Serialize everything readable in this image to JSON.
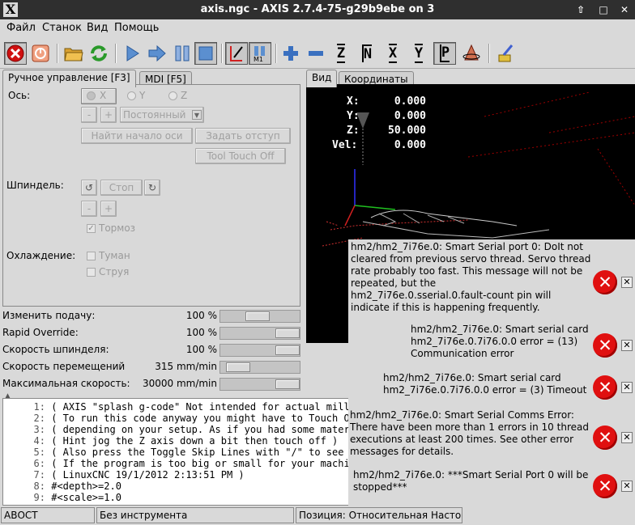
{
  "window": {
    "title": "axis.ngc - AXIS 2.7.4-75-g29b9ebe on 3",
    "logo": "X"
  },
  "menu": [
    "Файл",
    "Станок",
    "Вид",
    "Помощь"
  ],
  "toolbar": {
    "axis_buttons": [
      "Z",
      "N",
      "X",
      "Y",
      "P"
    ],
    "icons": [
      "estop-icon",
      "power-icon",
      "open-file-icon",
      "reload-icon",
      "run-icon",
      "step-icon",
      "pause-icon",
      "stop-icon",
      "skip-lines-icon",
      "optional-stop-icon",
      "zoom-in-icon",
      "zoom-out-icon",
      "view-z-icon",
      "view-z2-icon",
      "view-x-icon",
      "view-y-icon",
      "view-p-icon",
      "rotate-icon",
      "clear-plot-icon"
    ]
  },
  "left_tabs": [
    "Ручное управление [F3]",
    "MDI [F5]"
  ],
  "manual": {
    "axis_label": "Ось:",
    "axes": [
      "X",
      "Y",
      "Z"
    ],
    "minus": "-",
    "plus": "+",
    "jog_mode": "Постоянный",
    "home_button": "Найти начало оси",
    "offset_button": "Задать отступ",
    "touch_off_button": "Tool Touch Off",
    "spindle_label": "Шпиндель:",
    "spindle_stop": "Стоп",
    "brake_label": "Тормоз",
    "coolant_label": "Охлаждение:",
    "mist_label": "Туман",
    "flood_label": "Струя"
  },
  "sliders": [
    {
      "label": "Изменить подачу:",
      "value": "100 %",
      "level": 0.45
    },
    {
      "label": "Rapid Override:",
      "value": "100 %",
      "level": 1.0
    },
    {
      "label": "Скорость шпинделя:",
      "value": "100 %",
      "level": 1.0
    },
    {
      "label": "Скорость перемещений",
      "value": "315 mm/min",
      "level": 0.1
    },
    {
      "label": "Максимальная скорость:",
      "value": "30000 mm/min",
      "level": 1.0
    }
  ],
  "right_tabs": [
    "Вид",
    "Координаты"
  ],
  "dro": {
    "x_label": "X:",
    "x_value": "0.000",
    "y_label": "Y:",
    "y_value": "0.000",
    "z_label": "Z:",
    "z_value": "50.000",
    "vel_label": "Vel:",
    "vel_value": "0.000"
  },
  "code_lines": [
    {
      "num": "1:",
      "text": "( AXIS \"splash g-code\" Not intended for actual millin"
    },
    {
      "num": "2:",
      "text": "( To run this code anyway you might have to Touch Off"
    },
    {
      "num": "3:",
      "text": "( depending on your setup. As if you had some materia"
    },
    {
      "num": "4:",
      "text": "( Hint jog the Z axis down a bit then touch off )"
    },
    {
      "num": "5:",
      "text": "( Also press the Toggle Skip Lines with \"/\" to see th"
    },
    {
      "num": "6:",
      "text": "( If the program is too big or small for your machine"
    },
    {
      "num": "7:",
      "text": "( LinuxCNC 19/1/2012 2:13:51 PM )"
    },
    {
      "num": "8:",
      "text": "#<depth>=2.0"
    },
    {
      "num": "9:",
      "text": "#<scale>=1.0"
    }
  ],
  "status": {
    "state": "АВОСТ",
    "tool": "Без инструмента",
    "position": "Позиция: Относительная Насто"
  },
  "errors": [
    {
      "lines": [
        "hm2/hm2_7i76e.0: Smart Serial port 0: DoIt not",
        "cleared from previous servo thread. Servo thread",
        "rate probably too fast. This message will not be",
        "repeated, but the",
        "hm2_7i76e.0.sserial.0.fault-count pin will",
        "indicate if this is happening frequently."
      ]
    },
    {
      "lines": [
        "hm2/hm2_7i76e.0: Smart serial card",
        "hm2_7i76e.0.7i76.0.0 error = (13)",
        "Communication error"
      ]
    },
    {
      "lines": [
        "hm2/hm2_7i76e.0: Smart serial card",
        "hm2_7i76e.0.7i76.0.0 error = (3) Timeout"
      ]
    },
    {
      "lines": [
        "hm2/hm2_7i76e.0: Smart Serial Comms Error:",
        "There have been more than 1 errors in 10 thread",
        "executions at least 200 times. See other error",
        "messages for details."
      ]
    },
    {
      "lines": [
        "hm2/hm2_7i76e.0: ***Smart Serial Port 0 will be",
        "stopped***"
      ]
    }
  ]
}
